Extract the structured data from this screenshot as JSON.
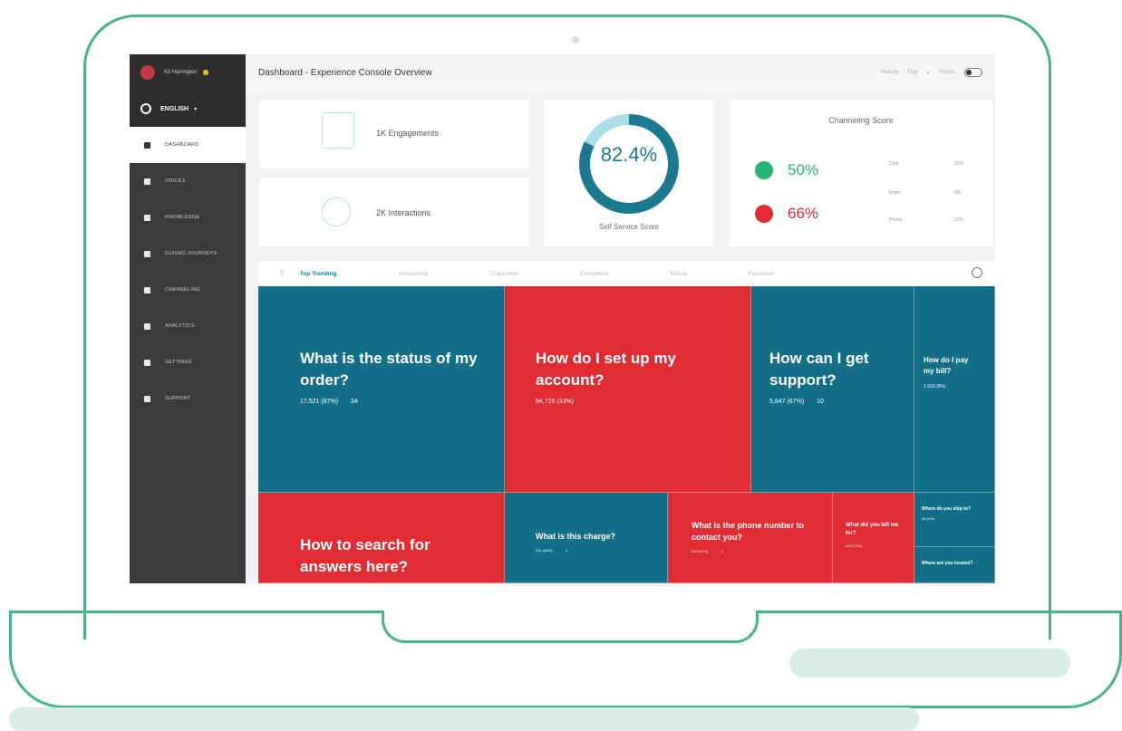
{
  "colors": {
    "frame": "#47b38a",
    "teal": "#136f88",
    "red": "#e02c32",
    "ring_light": "#a9dde8",
    "ring_dark": "#1b7a90",
    "green_badge": "#22b573"
  },
  "sidebar": {
    "user_name": "Kit Harrington",
    "language": "ENGLISH",
    "items": [
      {
        "label": "DASHBOARD",
        "icon": "home-icon",
        "active": true
      },
      {
        "label": "VOICES",
        "icon": "megaphone-icon",
        "active": false
      },
      {
        "label": "KNOWLEDGE",
        "icon": "book-icon",
        "active": false
      },
      {
        "label": "GUIDED JOURNEYS",
        "icon": "bulb-icon",
        "active": false
      },
      {
        "label": "CHANNELING",
        "icon": "fork-icon",
        "active": false
      },
      {
        "label": "ANALYTICS",
        "icon": "pie-icon",
        "active": false
      },
      {
        "label": "SETTINGS",
        "icon": "gear-icon",
        "active": false
      },
      {
        "label": "SUPPORT",
        "icon": "support-icon",
        "active": false
      }
    ]
  },
  "topbar": {
    "title": "Dashboard - Experience Console Overview",
    "view_by": "View by",
    "range": "Day",
    "trends": "Trends"
  },
  "cards": {
    "engagements": "1K Engagements",
    "interactions": "2K Interactions",
    "self_service": {
      "value": "82.4%",
      "label": "Self Service Score",
      "percent": 82.4
    },
    "channeling": {
      "title": "Channeling Score",
      "top_pct": "50%",
      "bottom_pct": "66%",
      "rows": [
        {
          "label": "Chat",
          "value": "32%"
        },
        {
          "label": "Email",
          "value": "4%"
        },
        {
          "label": "Phone",
          "value": "12%"
        }
      ]
    }
  },
  "tabs": [
    "Top Trending",
    "Unresolved",
    "Channeled",
    "Completed",
    "Muted",
    "Feedback"
  ],
  "tiles": [
    {
      "question": "What is the status of my order?",
      "views": "17,521 (87%)",
      "extra": "34",
      "color": "blue"
    },
    {
      "question": "How do I set up my account?",
      "views": "94,726 (33%)",
      "extra": "",
      "color": "red"
    },
    {
      "question": "How can I get support?",
      "views": "5,847 (67%)",
      "extra": "10",
      "color": "blue"
    },
    {
      "question": "How do I pay my bill?",
      "views": "1,910 (6%)",
      "extra": "",
      "color": "blue"
    },
    {
      "question": "How to search for answers here?",
      "views": "",
      "extra": "",
      "color": "red"
    },
    {
      "question": "What is this charge?",
      "views": "931 (84%)",
      "extra": "4",
      "color": "blue"
    },
    {
      "question": "What is the phone number to contact you?",
      "views": "603 (61%)",
      "extra": "3",
      "color": "red"
    },
    {
      "question": "What did you bill me for?",
      "views": "614 (73%)",
      "extra": "",
      "color": "red"
    },
    {
      "question": "Where do you ship to?",
      "views": "49 (4%)",
      "extra": "",
      "color": "blue"
    },
    {
      "question": "Where are you located?",
      "views": "",
      "extra": "",
      "color": "blue"
    }
  ]
}
